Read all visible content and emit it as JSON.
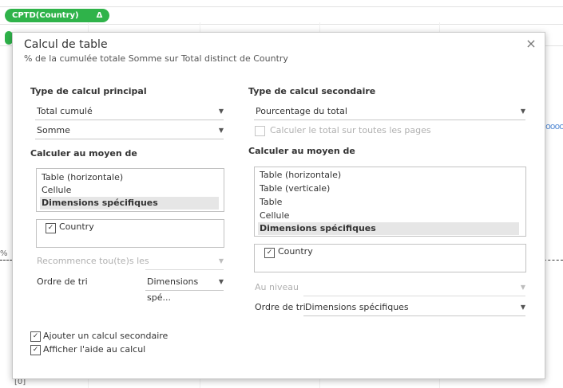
{
  "background": {
    "pill1_label": "CPTD(Country)",
    "pill_delta": "Δ",
    "right_glyphs": "oooo",
    "left_fragment": "%",
    "bottom_fragment": "[0]"
  },
  "dialog": {
    "title": "Calcul de table",
    "subtitle": "% de la cumulée totale Somme sur Total distinct de Country",
    "close_glyph": "×"
  },
  "primary": {
    "heading": "Type de calcul principal",
    "calc_type": "Total cumulé",
    "aggregation": "Somme",
    "compute_using_heading": "Calculer au moyen de",
    "compute_options": [
      "Table (horizontale)",
      "Cellule",
      "Dimensions spécifiques"
    ],
    "selected_option": "Dimensions spécifiques",
    "dimension_checkbox": "Country",
    "restart_label": "Recommence tou(te)s les",
    "sort_label": "Ordre de tri",
    "sort_value": "Dimensions spé..."
  },
  "secondary": {
    "heading": "Type de calcul secondaire",
    "calc_type": "Pourcentage du total",
    "all_pages_checkbox": "Calculer le total sur toutes les pages",
    "compute_using_heading": "Calculer au moyen de",
    "compute_options": [
      "Table (horizontale)",
      "Table (verticale)",
      "Table",
      "Cellule",
      "Dimensions spécifiques"
    ],
    "selected_option": "Dimensions spécifiques",
    "dimension_checkbox": "Country",
    "level_label": "Au niveau",
    "sort_label": "Ordre de tri",
    "sort_value": "Dimensions spécifiques"
  },
  "footer": {
    "add_secondary_checkbox": "Ajouter un calcul secondaire",
    "show_help_checkbox": "Afficher l'aide au calcul"
  },
  "glyphs": {
    "arrow": "▼",
    "check": "✓"
  },
  "colors": {
    "pill_green": "#2fb34a",
    "selected_row": "#e6e6e6"
  }
}
